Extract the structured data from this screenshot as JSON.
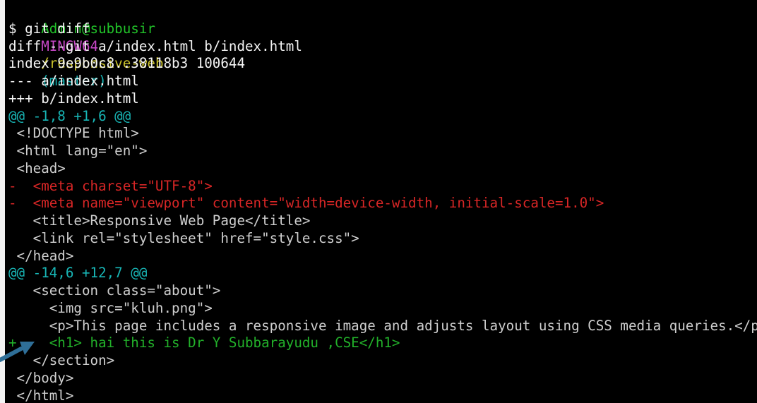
{
  "prompt": {
    "user_host": "Admin@subbusir",
    "system": "MINGW64",
    "path": "/responsive-web",
    "branch": "(master)"
  },
  "command": "$ git diff",
  "diff_header": {
    "line1": "diff --git a/index.html b/index.html",
    "line2": "index 9e9b0c8..38118b3 100644",
    "line3": "--- a/index.html",
    "line4": "+++ b/index.html"
  },
  "hunk1": {
    "header": "@@ -1,8 +1,6 @@",
    "lines": [
      " <!DOCTYPE html>",
      " <html lang=\"en\">",
      " <head>",
      "-  <meta charset=\"UTF-8\">",
      "-  <meta name=\"viewport\" content=\"width=device-width, initial-scale=1.0\">",
      "   <title>Responsive Web Page</title>",
      "   <link rel=\"stylesheet\" href=\"style.css\">",
      " </head>"
    ]
  },
  "hunk2": {
    "header": "@@ -14,6 +12,7 @@",
    "lines": [
      "   <section class=\"about\">",
      "     <img src=\"kluh.png\">",
      "     <p>This page includes a responsive image and adjusts layout using CSS media queries.</p>",
      "+    <h1> hai this is Dr Y Subbarayudu ,CSE</h1>",
      "   </section>",
      " </body>",
      " </html>"
    ]
  },
  "colors": {
    "background": "#000000",
    "text": "#d7d7d7",
    "prompt_user": "#21c129",
    "prompt_system": "#c848c8",
    "prompt_path": "#c9c12a",
    "prompt_branch": "#18b6b6",
    "hunk_header": "#18b6b6",
    "removed": "#d82626",
    "added": "#22b12a",
    "arrow": "#2f6f98"
  },
  "icons": {
    "annotation": "arrow-icon"
  }
}
